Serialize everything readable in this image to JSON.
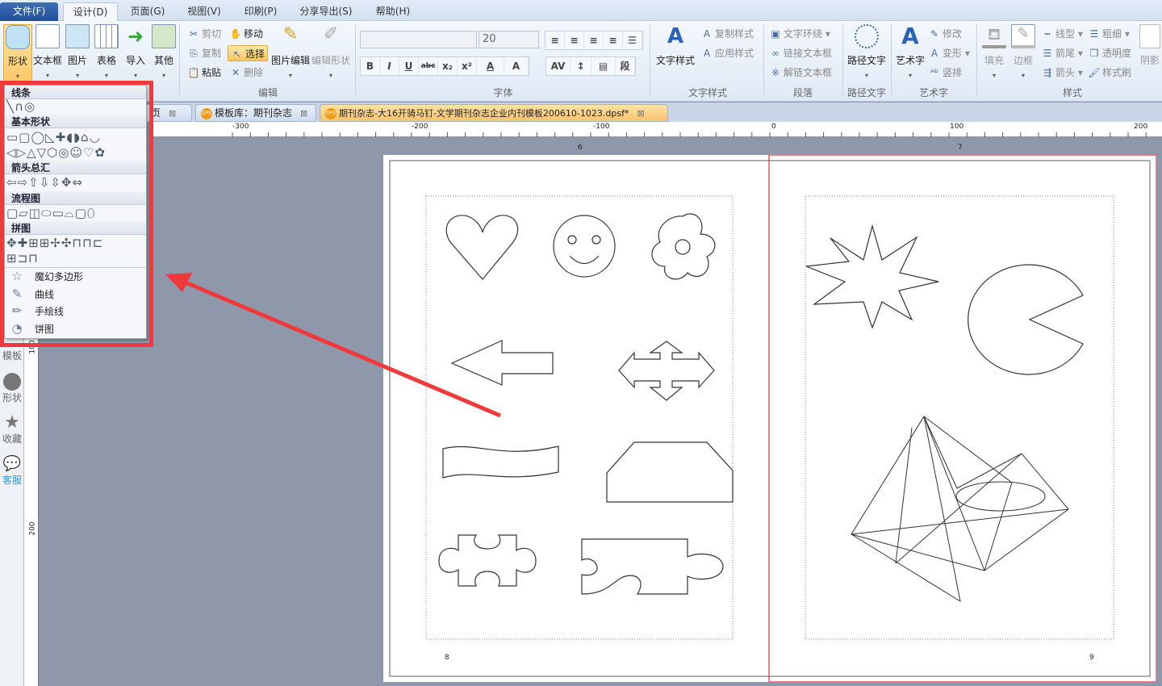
{
  "menu": {
    "tabs": [
      "文件(F)",
      "设计(D)",
      "页面(G)",
      "视图(V)",
      "印刷(P)",
      "分享导出(S)",
      "帮助(H)"
    ]
  },
  "ribbon": {
    "insert": [
      "形状",
      "文本框",
      "图片",
      "表格",
      "导入",
      "其他"
    ],
    "edit": {
      "cut": "剪切",
      "copy": "复制",
      "paste": "粘贴",
      "move": "移动",
      "select": "选择",
      "delete": "删除",
      "image_edit": "图片编辑",
      "edit_shape": "编辑形状",
      "label": "编辑"
    },
    "font": {
      "name": "",
      "size": "20",
      "label": "字体",
      "format": [
        "B",
        "I",
        "U",
        "abc",
        "x₂",
        "x²",
        "A",
        "A"
      ]
    },
    "text_style": {
      "big": "文字样式",
      "copy": "复制样式",
      "apply": "应用样式",
      "label": "文字样式"
    },
    "paragraph": {
      "wrap": "文字环绕",
      "link": "链接文本框",
      "unlink": "解链文本框",
      "label": "段落"
    },
    "path_text": {
      "big": "路径文字",
      "label": "路径文字"
    },
    "art": {
      "big": "艺术字",
      "modify": "修改",
      "transform": "变形",
      "vertical": "竖排",
      "label": "艺术字"
    },
    "style": {
      "fill": "填充",
      "border": "边框",
      "line_type": "线型",
      "tail": "箭尾",
      "head": "箭头",
      "weight": "粗细",
      "opacity": "透明度",
      "brush": "样式刷",
      "shadow": "阴影",
      "label": "样式"
    }
  },
  "doc_tabs": [
    "页",
    "模板库：期刊杂志",
    "期刊杂志-大16开骑马钉-文学期刊杂志企业内刊模板200610-1023.dpsf*"
  ],
  "ruler": {
    "h": [
      "-300",
      "-200",
      "-100",
      "0",
      "100",
      "200"
    ],
    "v": [
      "100",
      "200"
    ],
    "page_marks": [
      "6",
      "7"
    ]
  },
  "sidebar": [
    "模板",
    "形状",
    "收藏",
    "客服"
  ],
  "shape_panel": {
    "sections": [
      {
        "title": "线条",
        "rows": [
          "╲∩◎"
        ]
      },
      {
        "title": "基本形状",
        "rows": [
          "▭▢◯◺✚◖◗⌂◡",
          "◁▷△▽⬡◎☺♡✿"
        ]
      },
      {
        "title": "箭头总汇",
        "rows": [
          "⇦⇨⇧⇩⇳✥⇔"
        ]
      },
      {
        "title": "流程图",
        "rows": [
          "▢▱◫⬭▭⌓▢⬯"
        ]
      },
      {
        "title": "拼图",
        "rows": [
          "✥✚⊞⊞✢✣⊓⊓⊏",
          "⊞⊐⊓"
        ]
      }
    ],
    "menu": [
      {
        "icon": "☆",
        "label": "魔幻多边形"
      },
      {
        "icon": "✎",
        "label": "曲线"
      },
      {
        "icon": "✏",
        "label": "手绘线"
      },
      {
        "icon": "◔",
        "label": "饼图"
      }
    ]
  },
  "pages": {
    "left": "8",
    "right": "9"
  },
  "colors": {
    "annotation": "#f0393a",
    "canvas": "#8e98aa",
    "accent": "#f8c565"
  }
}
